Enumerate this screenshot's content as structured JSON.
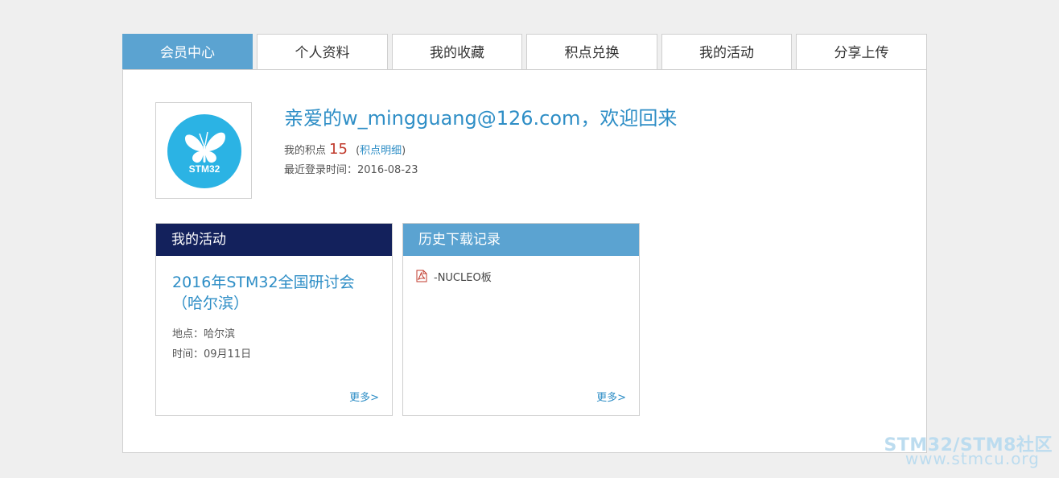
{
  "tabs": [
    {
      "label": "会员中心",
      "active": true
    },
    {
      "label": "个人资料",
      "active": false
    },
    {
      "label": "我的收藏",
      "active": false
    },
    {
      "label": "积点兑换",
      "active": false
    },
    {
      "label": "我的活动",
      "active": false
    },
    {
      "label": "分享上传",
      "active": false
    }
  ],
  "profile": {
    "avatar_text": "STM32",
    "welcome": "亲爱的w_mingguang@126.com，欢迎回来",
    "points_label": "我的积点",
    "points_value": "15",
    "points_link_open": "(",
    "points_link": "积点明细",
    "points_link_close": ")",
    "last_login_label": "最近登录时间：",
    "last_login_value": "2016-08-23"
  },
  "activity_card": {
    "header": "我的活动",
    "title": "2016年STM32全国研讨会（哈尔滨）",
    "location_label": "地点：",
    "location_value": "哈尔滨",
    "time_label": "时间：",
    "time_value": "09月11日",
    "more": "更多>"
  },
  "download_card": {
    "header": "历史下载记录",
    "items": [
      {
        "name": "-NUCLEO板",
        "icon": "pdf-icon"
      }
    ],
    "more": "更多>"
  },
  "watermark": {
    "line1": "STM32/STM8社区",
    "line2": "www.stmcu.org"
  },
  "colors": {
    "accent": "#5ba3d1",
    "dark_header": "#13215c",
    "link": "#2e8ec6",
    "points": "#c0392b"
  }
}
